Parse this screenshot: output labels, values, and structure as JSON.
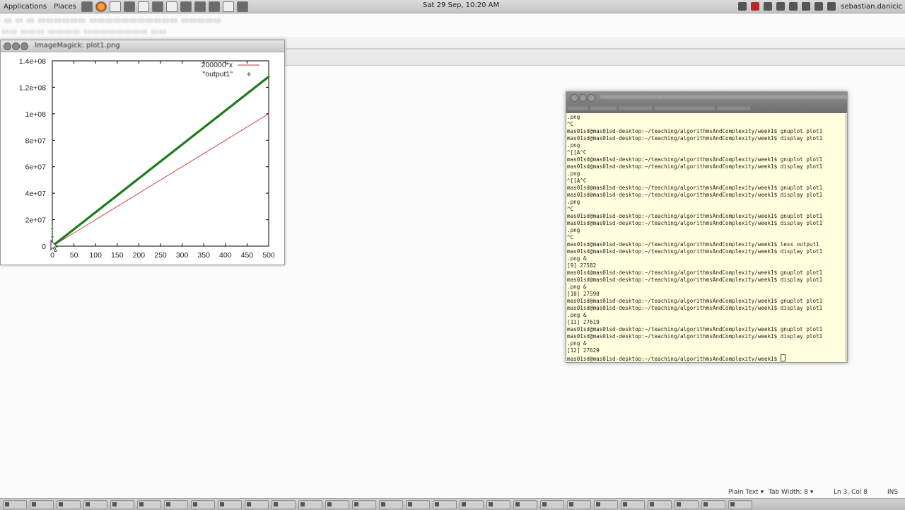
{
  "top_panel": {
    "menus": [
      "Applications",
      "Places"
    ],
    "clock": "Sat 29 Sep, 10:20 AM",
    "user": "sebastian.danicic"
  },
  "imagemagick": {
    "title": "ImageMagick: plot1.png"
  },
  "chart_data": {
    "type": "line",
    "x_ticks": [
      "0",
      "50",
      "100",
      "150",
      "200",
      "250",
      "300",
      "350",
      "400",
      "450",
      "500"
    ],
    "y_ticks": [
      "0",
      "2e+07",
      "4e+07",
      "6e+07",
      "8e+07",
      "1e+08",
      "1.2e+08",
      "1.4e+08"
    ],
    "xlim": [
      0,
      500
    ],
    "ylim": [
      0,
      140000000
    ],
    "series": [
      {
        "name": "200000*x",
        "style": "line",
        "color": "#cc3333",
        "x": [
          0,
          500
        ],
        "y": [
          0,
          100000000
        ]
      },
      {
        "name": "\"output1\"",
        "style": "points",
        "color": "#1a7a1a",
        "x": [
          0,
          500
        ],
        "y": [
          0,
          128000000
        ],
        "outliers": [
          [
            0,
            13000000
          ],
          [
            0,
            7000000
          ]
        ]
      }
    ],
    "legend": "top-right"
  },
  "terminal": {
    "lines": [
      ".png",
      "^C",
      "mas01sd@mas01sd-desktop:~/teaching/algorithmsAndComplexity/week1$ gnuplot plot1",
      "mas01sd@mas01sd-desktop:~/teaching/algorithmsAndComplexity/week1$ display plot1",
      ".png",
      "^[[A^C",
      "mas01sd@mas01sd-desktop:~/teaching/algorithmsAndComplexity/week1$ gnuplot plot1",
      "mas01sd@mas01sd-desktop:~/teaching/algorithmsAndComplexity/week1$ display plot1",
      ".png",
      "^[[A^C",
      "mas01sd@mas01sd-desktop:~/teaching/algorithmsAndComplexity/week1$ gnuplot plot1",
      "mas01sd@mas01sd-desktop:~/teaching/algorithmsAndComplexity/week1$ display plot1",
      ".png",
      "^C",
      "mas01sd@mas01sd-desktop:~/teaching/algorithmsAndComplexity/week1$ gnuplot plot1",
      "mas01sd@mas01sd-desktop:~/teaching/algorithmsAndComplexity/week1$ display plot1",
      ".png",
      "^C",
      "mas01sd@mas01sd-desktop:~/teaching/algorithmsAndComplexity/week1$ less output1",
      "mas01sd@mas01sd-desktop:~/teaching/algorithmsAndComplexity/week1$ display plot1",
      ".png &",
      "[9] 27582",
      "mas01sd@mas01sd-desktop:~/teaching/algorithmsAndComplexity/week1$ gnuplot plot1",
      "mas01sd@mas01sd-desktop:~/teaching/algorithmsAndComplexity/week1$ display plot1",
      ".png &",
      "[10] 27590",
      "mas01sd@mas01sd-desktop:~/teaching/algorithmsAndComplexity/week1$ gnuplot plot1",
      "mas01sd@mas01sd-desktop:~/teaching/algorithmsAndComplexity/week1$ display plot1",
      ".png &",
      "[11] 27619",
      "mas01sd@mas01sd-desktop:~/teaching/algorithmsAndComplexity/week1$ gnuplot plot1",
      "mas01sd@mas01sd-desktop:~/teaching/algorithmsAndComplexity/week1$ display plot1",
      ".png &",
      "[12] 27629"
    ],
    "prompt": "mas01sd@mas01sd-desktop:~/teaching/algorithmsAndComplexity/week1$ "
  },
  "statusbar": {
    "syntax": "Plain Text ▾",
    "tab_width": "Tab Width: 8 ▾",
    "position": "Ln 3, Col 8",
    "mode": "INS"
  }
}
